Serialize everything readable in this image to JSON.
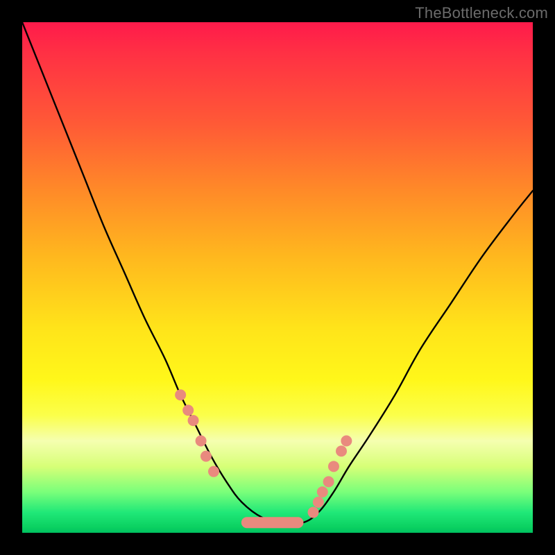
{
  "watermark": "TheBottleneck.com",
  "colors": {
    "dot": "#e98a7e",
    "curve": "#000000"
  },
  "chart_data": {
    "type": "line",
    "title": "",
    "xlabel": "",
    "ylabel": "",
    "xlim": [
      0,
      100
    ],
    "ylim": [
      0,
      100
    ],
    "grid": false,
    "legend": false,
    "series": [
      {
        "name": "bottleneck-curve",
        "x": [
          0,
          4,
          8,
          12,
          16,
          20,
          24,
          28,
          31,
          34,
          37,
          40,
          43,
          47,
          51,
          55,
          58,
          61,
          64,
          68,
          73,
          78,
          84,
          90,
          96,
          100
        ],
        "y": [
          100,
          90,
          80,
          70,
          60,
          51,
          42,
          34,
          27,
          21,
          15,
          10,
          6,
          3,
          2,
          2,
          4,
          8,
          13,
          19,
          27,
          36,
          45,
          54,
          62,
          67
        ]
      }
    ],
    "highlight_dots": {
      "left_cluster": [
        {
          "x": 31,
          "y": 27
        },
        {
          "x": 32.5,
          "y": 24
        },
        {
          "x": 33.5,
          "y": 22
        },
        {
          "x": 35,
          "y": 18
        },
        {
          "x": 36,
          "y": 15
        },
        {
          "x": 37.5,
          "y": 12
        }
      ],
      "right_cluster": [
        {
          "x": 57,
          "y": 4
        },
        {
          "x": 58,
          "y": 6
        },
        {
          "x": 58.8,
          "y": 8
        },
        {
          "x": 60,
          "y": 10
        },
        {
          "x": 61,
          "y": 13
        },
        {
          "x": 62.5,
          "y": 16
        },
        {
          "x": 63.5,
          "y": 18
        }
      ],
      "plateau": {
        "x1": 44,
        "x2": 54,
        "y": 2
      }
    },
    "background_gradient_stops": [
      {
        "pct": 0,
        "color": "#ff1a4b"
      },
      {
        "pct": 20,
        "color": "#ff5a36"
      },
      {
        "pct": 46,
        "color": "#ffb81e"
      },
      {
        "pct": 70,
        "color": "#fff71a"
      },
      {
        "pct": 92,
        "color": "#7aff7a"
      },
      {
        "pct": 100,
        "color": "#00c060"
      }
    ]
  }
}
